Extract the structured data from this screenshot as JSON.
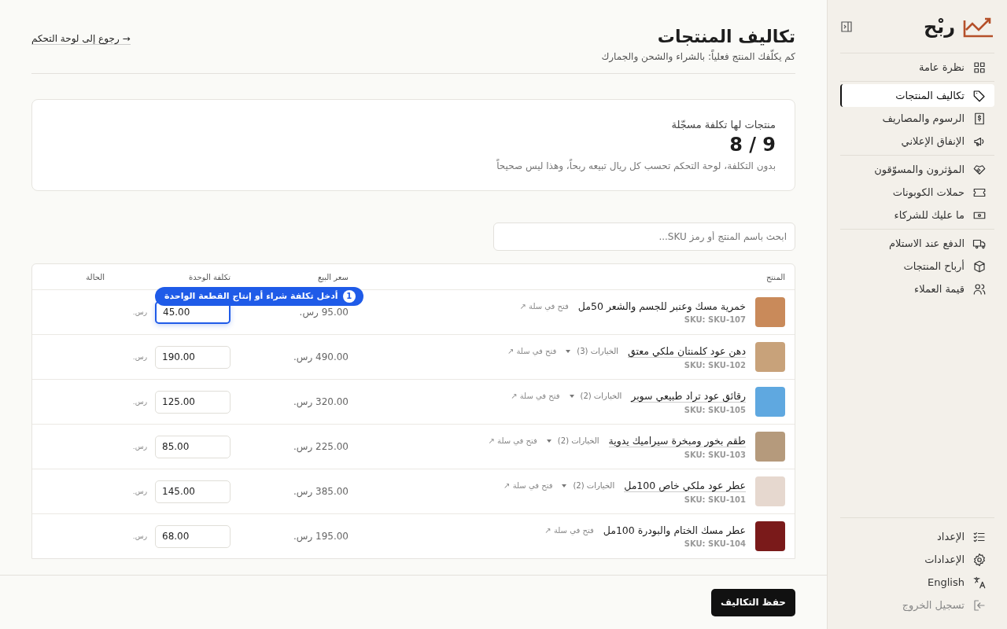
{
  "sidebar": {
    "brand": "ربْح",
    "groups": [
      [
        {
          "label": "نظرة عامة",
          "selected": false
        }
      ],
      [
        {
          "label": "تكاليف المنتجات",
          "selected": true
        },
        {
          "label": "الرسوم والمصاريف",
          "selected": false
        },
        {
          "label": "الإنفاق الإعلاني",
          "selected": false
        }
      ],
      [
        {
          "label": "المؤثرون والمسوّقون",
          "selected": false
        },
        {
          "label": "حملات الكوبونات",
          "selected": false
        },
        {
          "label": "ما عليك للشركاء",
          "selected": false
        }
      ],
      [
        {
          "label": "الدفع عند الاستلام",
          "selected": false
        },
        {
          "label": "أرباح المنتجات",
          "selected": false
        },
        {
          "label": "قيمة العملاء",
          "selected": false
        }
      ]
    ],
    "footer": [
      {
        "label": "الإعداد"
      },
      {
        "label": "الإعدادات"
      },
      {
        "label": "English"
      },
      {
        "label": "تسجيل الخروج"
      }
    ]
  },
  "header": {
    "title": "تكاليف المنتجات",
    "subtitle": "كم يكلّفك المنتج فعلياً: بالشراء والشحن والجمارك",
    "back_link": "→ رجوع إلى لوحة التحكم"
  },
  "summary": {
    "label": "منتجات لها تكلفة مسجّلة",
    "value": "8 / 9",
    "note": "بدون التكلفة، لوحة التحكم تحسب كل ريال تبيعه ربحاً، وهذا ليس صحيحاً"
  },
  "search": {
    "placeholder": "ابحث باسم المنتج أو رمز SKU..."
  },
  "table": {
    "columns": [
      "المنتج",
      "سعر البيع",
      "تكلفة الوحدة",
      "الحالة"
    ],
    "rows": [
      {
        "name": "خمرية مسك وعنبر للجسم والشعر 50مل",
        "link": "فتح في سلة ↗",
        "sku": "SKU: SKU-107",
        "price": "95.00 رس.",
        "cost": "45.00",
        "currency": "رس.",
        "focused": true
      },
      {
        "name": "دهن عود كلمنتان ملكي معتق",
        "options": "الخيارات (3)",
        "link": "فتح في سلة ↗",
        "sku": "SKU: SKU-102",
        "price": "490.00 رس.",
        "cost": "190.00",
        "currency": "رس.",
        "focused": false
      },
      {
        "name": "رقائق عود تراد طبيعي سوبر",
        "options": "الخيارات (2)",
        "link": "فتح في سلة ↗",
        "sku": "SKU: SKU-105",
        "price": "320.00 رس.",
        "cost": "125.00",
        "currency": "رس.",
        "focused": false
      },
      {
        "name": "طقم بخور ومبخرة سيراميك يدوية",
        "options": "الخيارات (2)",
        "link": "فتح في سلة ↗",
        "sku": "SKU: SKU-103",
        "price": "225.00 رس.",
        "cost": "85.00",
        "currency": "رس.",
        "focused": false
      },
      {
        "name": "عطر عود ملكي خاص 100مل",
        "options": "الخيارات (2)",
        "link": "فتح في سلة ↗",
        "sku": "SKU: SKU-101",
        "price": "385.00 رس.",
        "cost": "145.00",
        "currency": "رس.",
        "focused": false
      },
      {
        "name": "عطر مسك الختام والبودرة 100مل",
        "link": "فتح في سلة ↗",
        "sku": "SKU: SKU-104",
        "price": "195.00 رس.",
        "cost": "68.00",
        "currency": "رس.",
        "focused": false
      }
    ]
  },
  "tooltip": {
    "step": "1",
    "text": "أدخل تكلفة شراء أو إنتاج القطعة الواحدة"
  },
  "save_button": "حفظ التكاليف"
}
